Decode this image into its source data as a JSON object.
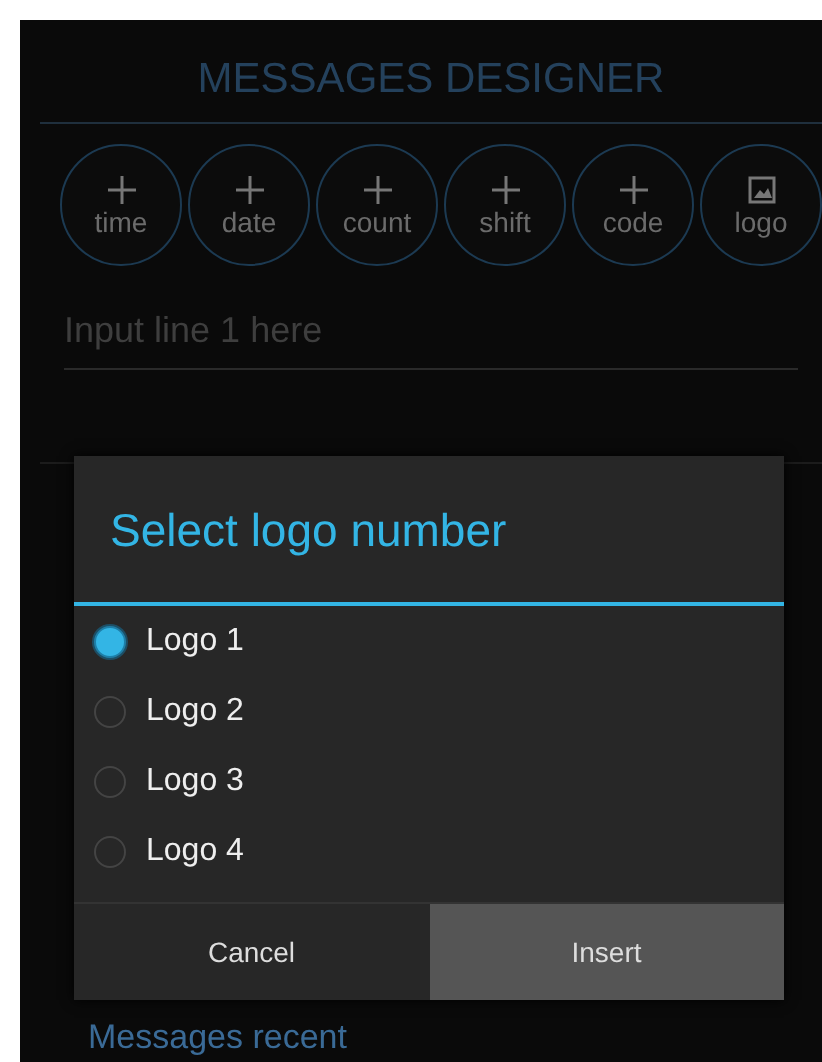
{
  "screen": {
    "title": "MESSAGES DESIGNER",
    "insert_buttons": [
      {
        "kind": "plus",
        "label": "time"
      },
      {
        "kind": "plus",
        "label": "date"
      },
      {
        "kind": "plus",
        "label": "count"
      },
      {
        "kind": "plus",
        "label": "shift"
      },
      {
        "kind": "plus",
        "label": "code"
      },
      {
        "kind": "image",
        "label": "logo"
      }
    ],
    "line_input": {
      "placeholder": "Input line 1 here"
    },
    "section_label": "Messages recent"
  },
  "dialog": {
    "title": "Select logo number",
    "options": [
      {
        "label": "Logo 1",
        "selected": true
      },
      {
        "label": "Logo 2",
        "selected": false
      },
      {
        "label": "Logo 3",
        "selected": false
      },
      {
        "label": "Logo 4",
        "selected": false
      }
    ],
    "buttons": [
      {
        "label": "Cancel",
        "selected": false
      },
      {
        "label": "Insert",
        "selected": true
      }
    ]
  }
}
